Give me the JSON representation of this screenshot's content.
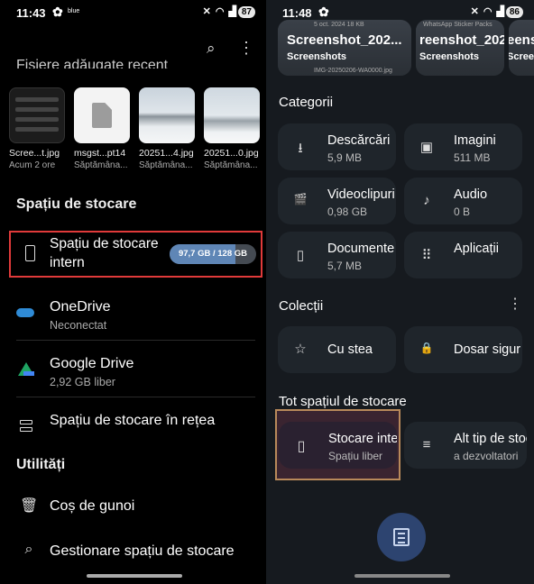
{
  "left": {
    "status": {
      "time": "11:43",
      "carrier": "blue",
      "battery": "87"
    },
    "recent_title": "Fișiere adăugate recent",
    "recent_files": [
      {
        "name": "Scree...t.jpg",
        "date": "Acum 2 ore",
        "thumb": "screenshot"
      },
      {
        "name": "msgst...pt14",
        "date": "Săptămâna...",
        "thumb": "document"
      },
      {
        "name": "20251...4.jpg",
        "date": "Săptămâna...",
        "thumb": "snow"
      },
      {
        "name": "20251...0.jpg",
        "date": "Săptămâna...",
        "thumb": "snow"
      }
    ],
    "storage_heading": "Spațiu de stocare",
    "internal": {
      "title_line1": "Spațiu de stocare",
      "title_line2": "intern",
      "used": "97,7 GB",
      "total": "128 GB",
      "usage_display": "97,7 GB / 128 GB",
      "used_fraction": 0.763
    },
    "onedrive": {
      "title": "OneDrive",
      "subtitle": "Neconectat"
    },
    "gdrive": {
      "title": "Google Drive",
      "subtitle": "2,92 GB liber"
    },
    "network": {
      "title": "Spațiu de stocare în rețea"
    },
    "utilities_heading": "Utilități",
    "trash": {
      "title": "Coș de gunoi"
    },
    "manage": {
      "title": "Gestionare spațiu de stocare"
    }
  },
  "right": {
    "status": {
      "time": "11:48",
      "battery": "86"
    },
    "cards": [
      {
        "big": "Screenshot_202...",
        "small": "Screenshots",
        "faint": "5 oct. 2024  18 KB"
      },
      {
        "big": "reenshot_202",
        "small": "Screenshots",
        "faint": "WhatsApp Sticker Packs"
      },
      {
        "big": "eenshot_202",
        "small": "Screenshots",
        "faint": ""
      }
    ],
    "categories_heading": "Categorii",
    "categories": [
      {
        "label": "Descărcări",
        "size": "5,9 MB",
        "icon": "download-icon",
        "glyph": "⭳"
      },
      {
        "label": "Imagini",
        "size": "511 MB",
        "icon": "image-icon",
        "glyph": "▣"
      },
      {
        "label": "Videoclipuri",
        "size": "0,98 GB",
        "icon": "video-icon",
        "glyph": "🎬"
      },
      {
        "label": "Audio",
        "size": "0 B",
        "icon": "music-icon",
        "glyph": "♪"
      },
      {
        "label": "Documente",
        "size": "5,7 MB",
        "icon": "document-icon",
        "glyph": "▯"
      },
      {
        "label": "Aplicații",
        "size": "",
        "icon": "apps-icon",
        "glyph": "⠿"
      }
    ],
    "collections_heading": "Colecții",
    "collections": [
      {
        "label": "Cu stea",
        "icon": "star-icon",
        "glyph": "☆"
      },
      {
        "label": "Dosar sigur",
        "icon": "lock-icon",
        "glyph": "🔒"
      }
    ],
    "all_storage_heading": "Tot spațiul de stocare",
    "all_storage": [
      {
        "label": "Stocare internă",
        "sub": "Spațiu liber",
        "icon": "phone-icon",
        "glyph": "▯"
      },
      {
        "label": "Alt tip de stocare",
        "sub": "a dezvoltatori",
        "icon": "storage-list-icon",
        "glyph": "≡"
      }
    ]
  },
  "colors": {
    "highlight_red": "#e03a3a",
    "highlight_orange": "#b8895a",
    "usage_fill": "#5f86b6",
    "fab_bg": "#2d4470"
  }
}
